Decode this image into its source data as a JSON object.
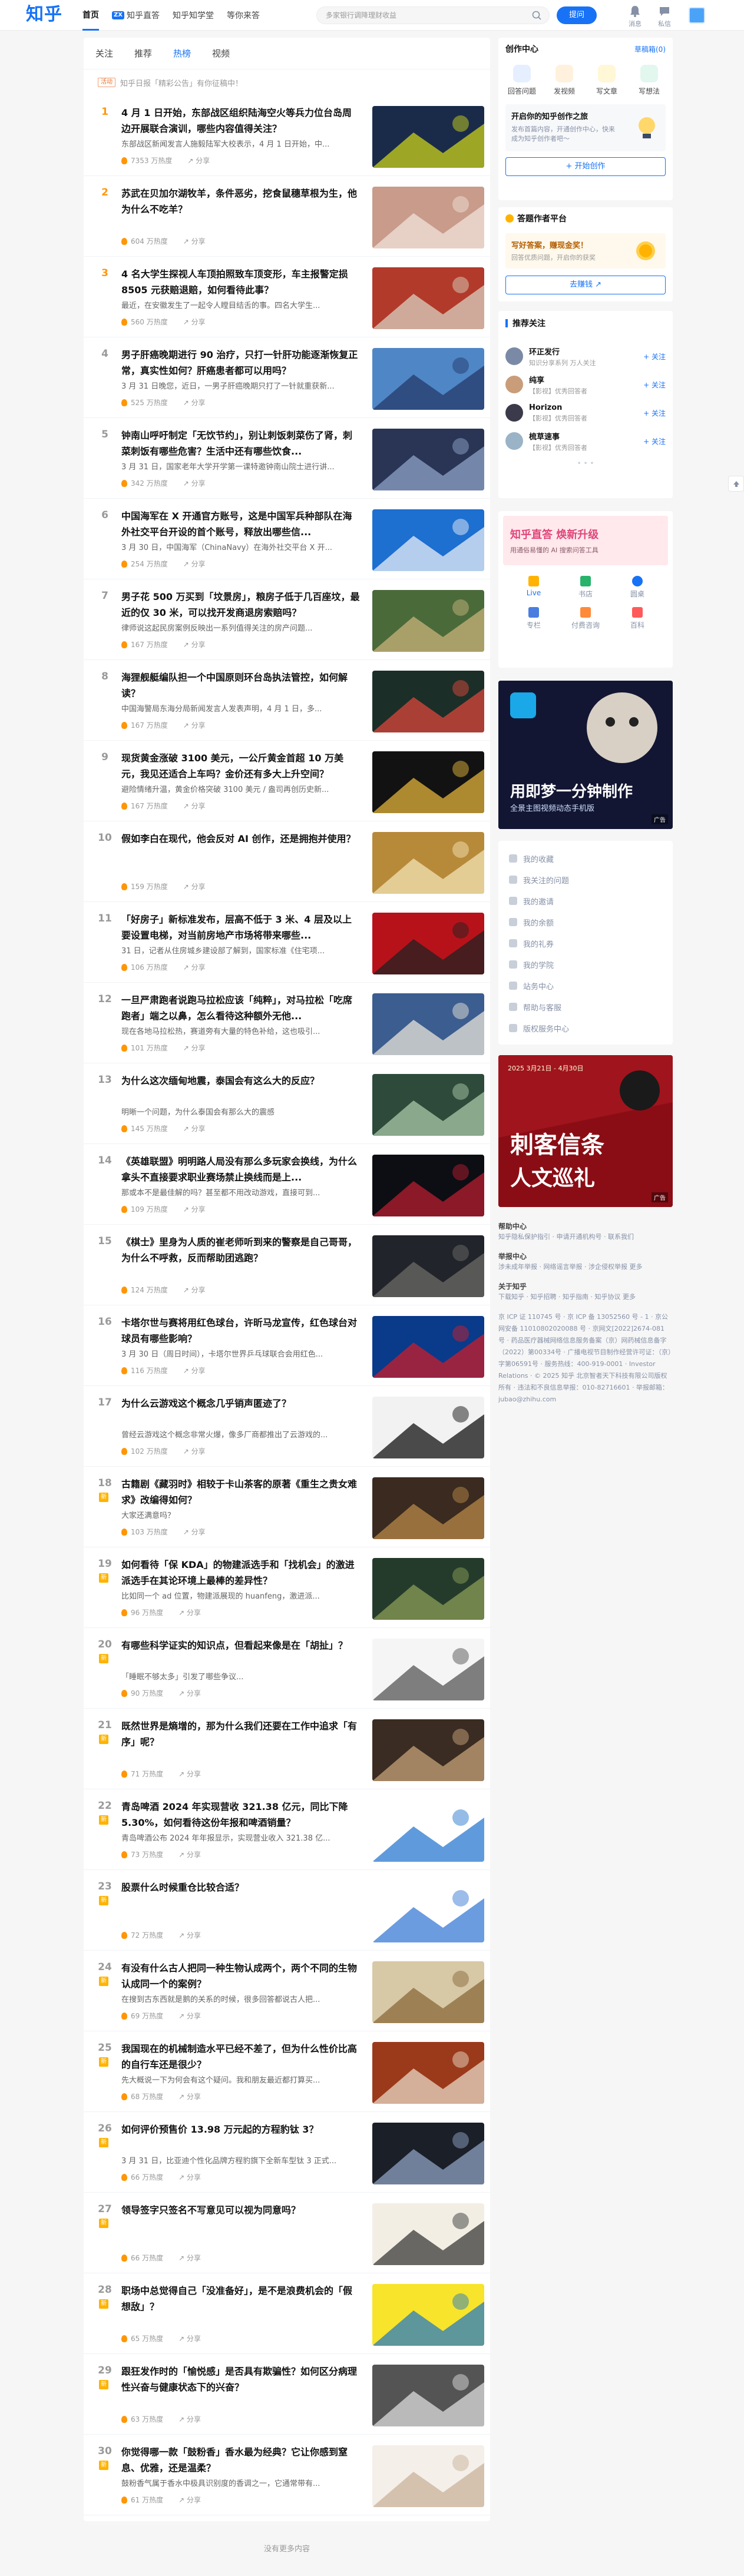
{
  "header": {
    "logo": "知乎",
    "nav": [
      {
        "label": "首页",
        "active": true
      },
      {
        "label": "知乎直答",
        "badge": "ZX"
      },
      {
        "label": "知乎知学堂"
      },
      {
        "label": "等你来答"
      }
    ],
    "search_placeholder": "多家银行调降理财收益",
    "ask_button": "提问",
    "icons": [
      {
        "name": "消息",
        "icon": "bell-icon"
      },
      {
        "name": "私信",
        "icon": "chat-icon"
      }
    ]
  },
  "tabs": [
    {
      "label": "关注"
    },
    {
      "label": "推荐"
    },
    {
      "label": "热榜",
      "active": true
    },
    {
      "label": "视频"
    }
  ],
  "notice": {
    "tag": "活动",
    "text": "知乎日报「精彩公告」有你征稿中！"
  },
  "hot_list": [
    {
      "rank": "1",
      "title": "4 月 1 日开始，东部战区组织陆海空火等兵力位台岛周边开展联合演训，哪些内容值得关注？",
      "excerpt": "东部战区新闻发言人施毅陆军大校表示，4 月 1 日开始，中...",
      "heat": "7353 万热度",
      "share": "分享",
      "thumb": [
        "#1a2b4a",
        "#c9d21a"
      ]
    },
    {
      "rank": "2",
      "title": "苏武在贝加尔湖牧羊，条件恶劣，挖食鼠穗草根为生，他为什么不吃羊？",
      "excerpt": "",
      "heat": "604 万热度",
      "share": "分享",
      "thumb": [
        "#c99b8a",
        "#f0e1d8"
      ]
    },
    {
      "rank": "3",
      "title": "4 名大学生探视人车顶拍照致车顶变形，车主报警定损 8505 元获赔退赔，如何看待此事？",
      "excerpt": "最近，在安徽发生了一起令人瞠目结舌的事。四名大学生...",
      "heat": "560 万热度",
      "share": "分享",
      "thumb": [
        "#b23a2a",
        "#d8d0c0"
      ]
    },
    {
      "rank": "4",
      "title": "男子肝癌晚期进行 90 治疗，只打一针肝功能逐渐恢复正常，真实性如何？肝癌患者都可以用吗？",
      "excerpt": "3 月 31 日晚您，近日，一男子肝癌晚期只打了一针就重获新...",
      "heat": "525 万热度",
      "share": "分享",
      "thumb": [
        "#4f86c6",
        "#243a6a"
      ]
    },
    {
      "rank": "5",
      "title": "钟南山呼吁制定「无饮节约」，别让刺饭刺菜伤了肾，刺菜刺饭有哪些危害？生活中还有哪些饮食...",
      "excerpt": "3 月 31 日，国家老年大学开学第一课特邀钟南山院士进行讲...",
      "heat": "342 万热度",
      "share": "分享",
      "thumb": [
        "#2a3556",
        "#8ea3c8"
      ]
    },
    {
      "rank": "6",
      "title": "中国海军在 X 开通官方账号，这是中国军兵种部队在海外社交平台开设的首个账号，释放出哪些信...",
      "excerpt": "3 月 30 日，中国海军（ChinaNavy）在海外社交平台 X 开...",
      "heat": "254 万热度",
      "share": "分享",
      "thumb": [
        "#1d6fd0",
        "#e8eef8"
      ]
    },
    {
      "rank": "7",
      "title": "男子花 500 万买到「坟景房」，粮房子低于几百座坟，最近的仅 30 米，可以找开发商退房索赔吗？",
      "excerpt": "律师说这起民房案例反映出一系列值得关注的房产问题...",
      "heat": "167 万热度",
      "share": "分享",
      "thumb": [
        "#4b6a3a",
        "#c8b37a"
      ]
    },
    {
      "rank": "8",
      "title": "海狸舰艇编队担一个中国原则环台岛执法管控，如何解读？",
      "excerpt": "中国海警局东海分局新闻发言人发表声明，4 月 1 日，多...",
      "heat": "167 万热度",
      "share": "分享",
      "thumb": [
        "#1c2e28",
        "#d9473a"
      ]
    },
    {
      "rank": "9",
      "title": "现货黄金涨破 3100 美元，一公斤黄金首超 10 万美元，我见还适合上车吗？金价还有多大上升空间？",
      "excerpt": "避险情绪升温，黄金价格突破 3100 美元 / 盎司再创历史新...",
      "heat": "167 万热度",
      "share": "分享",
      "thumb": [
        "#121212",
        "#e2b33a"
      ]
    },
    {
      "rank": "10",
      "title": "假如李白在现代，他会反对 AI 创作，还是拥抱并使用？",
      "excerpt": "",
      "heat": "159 万热度",
      "share": "分享",
      "thumb": [
        "#b78a3a",
        "#f3e2b4"
      ]
    },
    {
      "rank": "11",
      "title": "「好房子」新标准发布，层高不低于 3 米、4 层及以上要设置电梯，对当前房地产市场将带来哪些...",
      "excerpt": "31 日，记者从住房城乡建设部了解到，国家标准《住宅项...",
      "heat": "106 万热度",
      "share": "分享",
      "thumb": [
        "#b7121a",
        "#222222"
      ]
    },
    {
      "rank": "12",
      "title": "一旦严肃跑者说跑马拉松应该「纯粹」，对马拉松「吃席跑者」端之以鼻，怎么看待这种额外无他...",
      "excerpt": "现在各地马拉松热，赛道旁有大量的特色补给，这也吸引...",
      "heat": "101 万热度",
      "share": "分享",
      "thumb": [
        "#3b5d8f",
        "#e9e4d8"
      ]
    },
    {
      "rank": "13",
      "title": "为什么这次缅甸地震，泰国会有这么大的反应？",
      "excerpt": "明晰一个问题，为什么泰国会有那么大的震感",
      "heat": "145 万热度",
      "share": "分享",
      "thumb": [
        "#2d4a3a",
        "#a9c9a8"
      ]
    },
    {
      "rank": "14",
      "title": "《英雄联盟》明明路人局没有那么多玩家会换线，为什么拿头不直接要求职业赛场禁止换线而是上...",
      "excerpt": "那或本不是最佳解的吗？甚至都不用改动游戏，直接可到...",
      "heat": "109 万热度",
      "share": "分享",
      "thumb": [
        "#0d0d14",
        "#b51e2e"
      ]
    },
    {
      "rank": "15",
      "title": "《棋士》里身为人质的崔老师听到来的警察是自己哥哥，为什么不呼救，反而帮助团逃跑？",
      "excerpt": "",
      "heat": "124 万热度",
      "share": "分享",
      "thumb": [
        "#21242a",
        "#6b6a66"
      ]
    },
    {
      "rank": "16",
      "title": "卡塔尔世与赛将用红色球台，许昕马龙宣传，红色球台对球员有哪些影响？",
      "excerpt": "3 月 30 日（周日时间），卡塔尔世界乒乓球联合会用红色...",
      "heat": "116 万热度",
      "share": "分享",
      "thumb": [
        "#0a3a8a",
        "#c91e2a"
      ]
    },
    {
      "rank": "17",
      "title": "为什么云游戏这个概念几乎销声匿迹了？",
      "excerpt": "曾经云游戏这个概念非常火爆，像多厂商都推出了云游戏的...",
      "heat": "102 万热度",
      "share": "分享",
      "thumb": [
        "#f2f2f2",
        "#111111"
      ]
    },
    {
      "rank": "18",
      "title": "古籍剧《藏羽时》相较于卡山茶客的原著《重生之贵女难求》改编得如何？",
      "excerpt": "大家还满意吗？",
      "heat": "103 万热度",
      "share": "分享",
      "thumb": [
        "#3a2a1f",
        "#b8884a"
      ]
    },
    {
      "rank": "19",
      "title": "如何看待「保 KDA」的物建派选手和「找机会」的激进派选手在其论环境上最棒的差异性？",
      "excerpt": "比如同一个 ad 位置，物建派展现的 huanfeng，激进派...",
      "heat": "96 万热度",
      "share": "分享",
      "thumb": [
        "#243b2c",
        "#8a9d55"
      ]
    },
    {
      "rank": "20",
      "title": "有哪些科学证实的知识点，但看起来像是在「胡扯」？",
      "excerpt": "「睡眠不够太多」引发了哪些争议...",
      "heat": "90 万热度",
      "share": "分享",
      "thumb": [
        "#f5f5f5",
        "#555555"
      ]
    },
    {
      "rank": "21",
      "title": "既然世界是熵增的，那为什么我们还要在工作中追求「有序」呢？",
      "excerpt": "",
      "heat": "71 万热度",
      "share": "分享",
      "thumb": [
        "#3a2c22",
        "#c6a27a"
      ]
    },
    {
      "rank": "22",
      "title": "青岛啤酒 2024 年实现营收 321.38 亿元，同比下降 5.30%，如何看待这份年报和啤酒销量？",
      "excerpt": "青岛啤酒公布 2024 年年报显示，实现营业收入 321.38 亿...",
      "heat": "73 万热度",
      "share": "分享",
      "thumb": [
        "#ffffff",
        "#2a7ad0"
      ]
    },
    {
      "rank": "23",
      "title": "股票什么时候重仓比较合适？",
      "excerpt": "",
      "heat": "72 万热度",
      "share": "分享",
      "thumb": [
        "#ffffff",
        "#3a7bd5"
      ]
    },
    {
      "rank": "24",
      "title": "有没有什么古人把同一种生物认成两个，两个不同的生物认成同一个的案例？",
      "excerpt": "在搜到古东西就是鹅的关系的时候，很多回答都说古人把...",
      "heat": "69 万热度",
      "share": "分享",
      "thumb": [
        "#d7c8a6",
        "#8a6a3a"
      ]
    },
    {
      "rank": "25",
      "title": "我国现在的机械制造水平已经不差了，但为什么性价比高的自行车还是很少？",
      "excerpt": "先大概说一下为何会有这个疑问。我和朋友最近都打算买...",
      "heat": "68 万热度",
      "share": "分享",
      "thumb": [
        "#9a3a1a",
        "#e7d7c4"
      ]
    },
    {
      "rank": "26",
      "title": "如何评价预售价 13.98 万元起的方程豹钛 3？",
      "excerpt": "3 月 31 日，比亚迪个性化品牌方程豹旗下全新车型钛 3 正式...",
      "heat": "66 万热度",
      "share": "分享",
      "thumb": [
        "#1b1f28",
        "#8da2c2"
      ]
    },
    {
      "rank": "27",
      "title": "领导签字只签名不写意见可以视为同意吗？",
      "excerpt": "",
      "heat": "66 万热度",
      "share": "分享",
      "thumb": [
        "#f3eee4",
        "#3a3a3a"
      ]
    },
    {
      "rank": "28",
      "title": "职场中总觉得自己「没准备好」，是不是浪费机会的「假想敌」？",
      "excerpt": "",
      "heat": "65 万热度",
      "share": "分享",
      "thumb": [
        "#f7e42b",
        "#2a7cc1"
      ]
    },
    {
      "rank": "29",
      "title": "跟狂发作时的「愉悦感」是否具有欺骗性？如何区分病理性兴奋与健康状态下的兴奋？",
      "excerpt": "",
      "heat": "63 万热度",
      "share": "分享",
      "thumb": [
        "#545454",
        "#dcdcdc"
      ]
    },
    {
      "rank": "30",
      "title": "你觉得哪一款「鼓粉香」香水最为经典？它让你感到窒息、优雅，还是温柔？",
      "excerpt": "鼓粉香气属于香水中极具识别度的香调之一，它通常带有...",
      "heat": "61 万热度",
      "share": "分享",
      "thumb": [
        "#f4efe9",
        "#c9b39a"
      ]
    }
  ],
  "no_more": "没有更多内容",
  "sidebar": {
    "creator": {
      "title": "创作中心",
      "more": "草稿箱(0)",
      "items": [
        "回答问题",
        "发视频",
        "写文章",
        "写想法"
      ],
      "promo_title": "开启你的知乎创作之旅",
      "promo_text": "发布首篇内容，开通创作中心，快来成为知乎创作者吧～",
      "button": "+ 开始创作"
    },
    "reward": {
      "title": "答题作者平台",
      "line1": "写好答案，赚现金奖！",
      "line2": "回答优质问题，开启你的获奖",
      "button": "去赚钱 ↗"
    },
    "recommend": {
      "title": "推荐关注",
      "users": [
        {
          "name": "环正发行",
          "desc": "知识分享系列 万人关注",
          "follow": "+ 关注"
        },
        {
          "name": "纯享",
          "desc": "【影视】优秀回答者",
          "follow": "+ 关注"
        },
        {
          "name": "Horizon",
          "desc": "【影视】优秀回答者",
          "follow": "+ 关注"
        },
        {
          "name": "梳草速事",
          "desc": "【影视】优秀回答者",
          "follow": "+ 关注"
        }
      ]
    },
    "banner_top": {
      "line1": "知乎直答 焕新升级",
      "line2": "用通俗易懂的 AI 搜索问答工具"
    },
    "quick": [
      "Live",
      "书店",
      "圆桌",
      "专栏",
      "付费咨询",
      "百科"
    ],
    "ad1": {
      "line1": "用即梦一分钟制作",
      "line2": "全景主图视频动态手机版",
      "tag": "广告"
    },
    "menu": [
      "我的收藏",
      "我关注的问题",
      "我的邀请",
      "我的余额",
      "我的礼券",
      "我的学院",
      "站务中心",
      "帮助与客服",
      "版权服务中心"
    ],
    "ad2": {
      "date": "2025 3月21日 - 4月30日",
      "line1": "刺客信条",
      "line2": "人文巡礼",
      "tag": "广告"
    },
    "footer": [
      {
        "title": "帮助中心",
        "text": "知乎隐私保护指引 · 申请开通机构号 · 联系我们"
      },
      {
        "title": "举报中心",
        "text": "涉未成年举报 · 网络谣言举报 · 涉企侵权举报 更多"
      },
      {
        "title": "关于知乎",
        "text": "下载知乎 · 知乎招聘 · 知乎指南 · 知乎协议 更多"
      }
    ],
    "legal": "京 ICP 证 110745 号 · 京 ICP 备 13052560 号 - 1 · 京公网安备 11010802020088 号 · 京网文[2022]2674-081 号 · 药品医疗器械网络信息服务备案（京）网药械信息备字（2022）第00334号 · 广播电视节目制作经营许可证：（京）字第06591号 · 服务热线：400-919-0001 · Investor Relations · © 2025 知乎 北京智者天下科技有限公司版权所有 · 违法和不良信息举报：010-82716601 · 举报邮箱：jubao@zhihu.com"
  },
  "colors": {
    "brand": "#1772f6",
    "top_rank": "#ff9607",
    "page_bg": "#f6f6f6"
  }
}
